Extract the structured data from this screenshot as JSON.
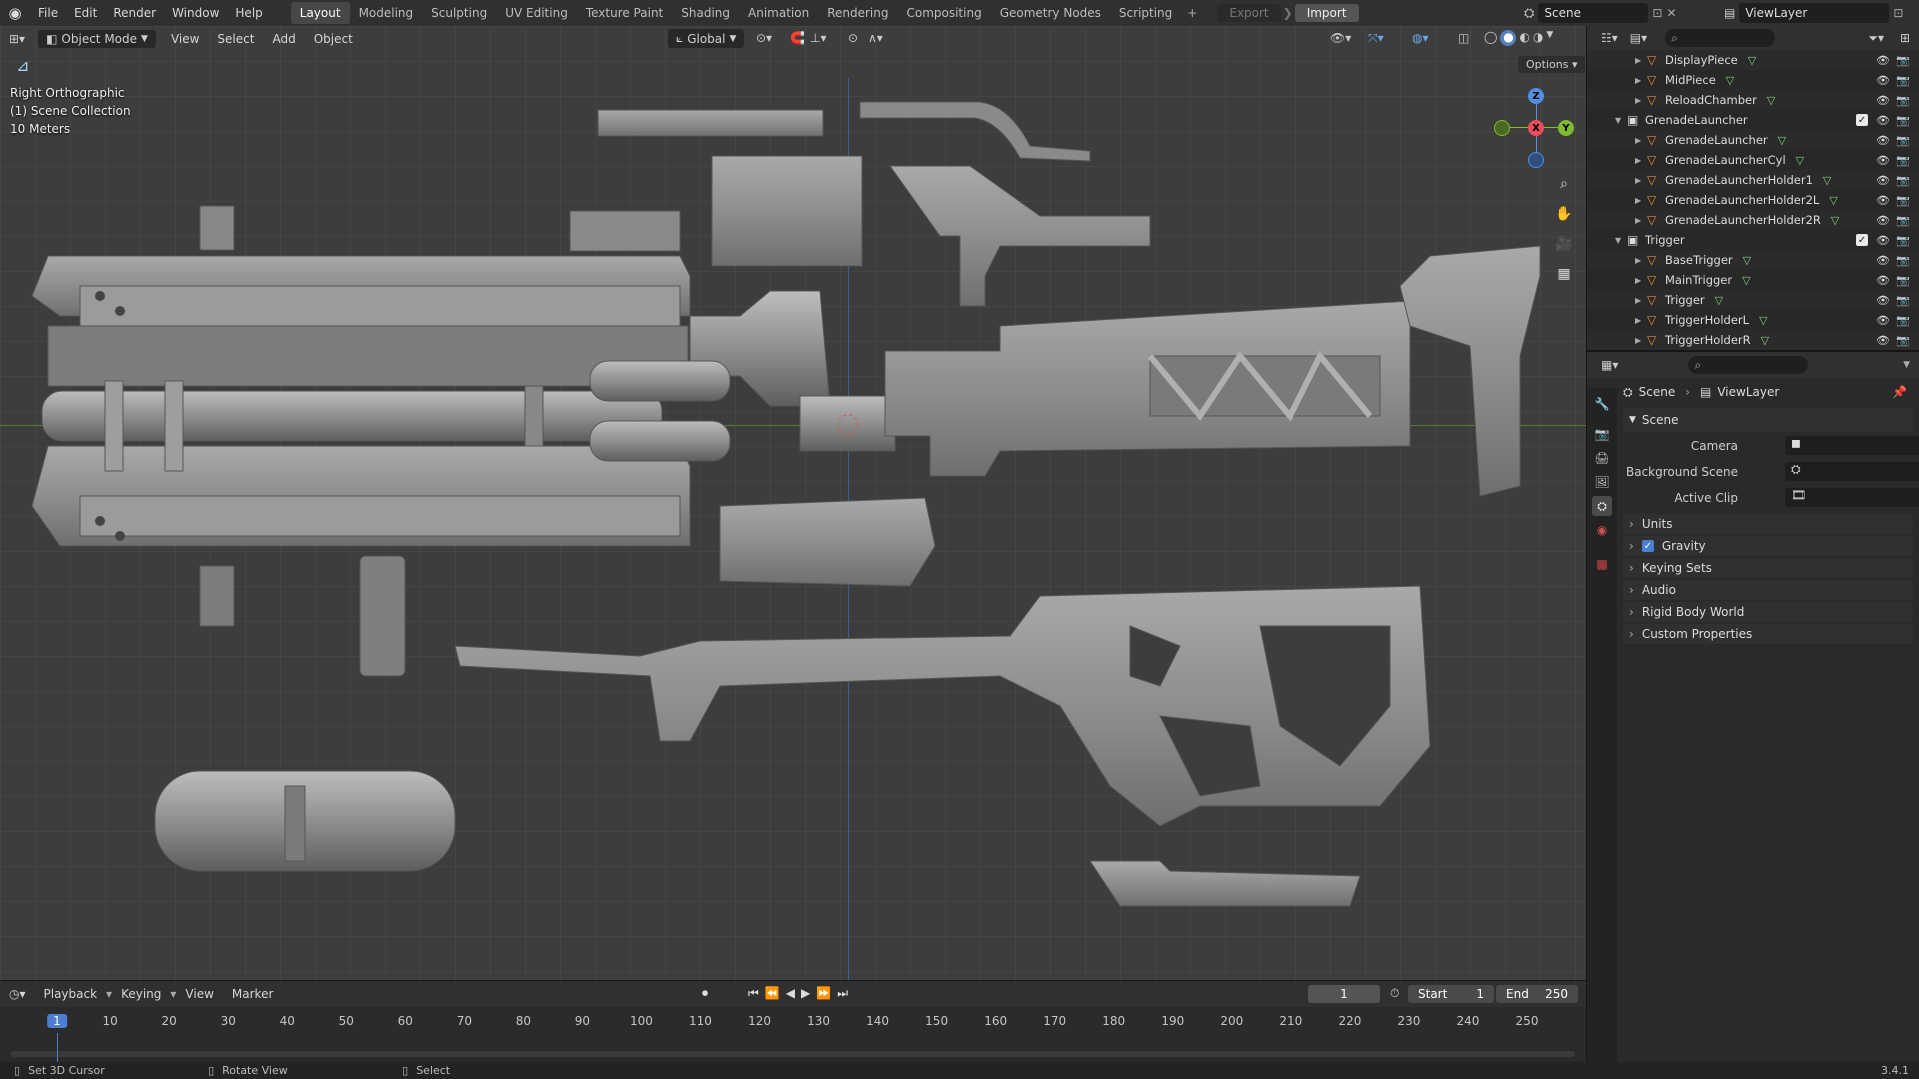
{
  "topbar": {
    "menus": [
      "File",
      "Edit",
      "Render",
      "Window",
      "Help"
    ],
    "workspaces": [
      "Layout",
      "Modeling",
      "Sculpting",
      "UV Editing",
      "Texture Paint",
      "Shading",
      "Animation",
      "Rendering",
      "Compositing",
      "Geometry Nodes",
      "Scripting"
    ],
    "active_workspace": "Layout",
    "export_label": "Export",
    "import_label": "Import",
    "scene_name": "Scene",
    "view_layer": "ViewLayer"
  },
  "viewport": {
    "mode": "Object Mode",
    "menus": [
      "View",
      "Select",
      "Add",
      "Object"
    ],
    "orientation": "Global",
    "options_label": "Options",
    "view_name": "Right Orthographic",
    "collection_label": "(1) Scene Collection",
    "scale_label": "10 Meters",
    "gizmo_axes": {
      "z": "Z",
      "x": "X",
      "y": "Y"
    }
  },
  "outliner": {
    "rows": [
      {
        "name": "DisplayPiece",
        "level": 2,
        "type": "mesh"
      },
      {
        "name": "MidPiece",
        "level": 2,
        "type": "mesh"
      },
      {
        "name": "ReloadChamber",
        "level": 2,
        "type": "mesh"
      },
      {
        "name": "GrenadeLauncher",
        "level": 1,
        "type": "collection"
      },
      {
        "name": "GrenadeLauncher",
        "level": 2,
        "type": "mesh"
      },
      {
        "name": "GrenadeLauncherCyl",
        "level": 2,
        "type": "mesh"
      },
      {
        "name": "GrenadeLauncherHolder1",
        "level": 2,
        "type": "mesh"
      },
      {
        "name": "GrenadeLauncherHolder2L",
        "level": 2,
        "type": "mesh"
      },
      {
        "name": "GrenadeLauncherHolder2R",
        "level": 2,
        "type": "mesh"
      },
      {
        "name": "Trigger",
        "level": 1,
        "type": "collection"
      },
      {
        "name": "BaseTrigger",
        "level": 2,
        "type": "mesh"
      },
      {
        "name": "MainTrigger",
        "level": 2,
        "type": "mesh"
      },
      {
        "name": "Trigger",
        "level": 2,
        "type": "mesh"
      },
      {
        "name": "TriggerHolderL",
        "level": 2,
        "type": "mesh"
      },
      {
        "name": "TriggerHolderR",
        "level": 2,
        "type": "mesh"
      }
    ]
  },
  "properties": {
    "breadcrumb": {
      "scene": "Scene",
      "view_layer": "ViewLayer"
    },
    "scene_panel_title": "Scene",
    "fields": {
      "camera": "Camera",
      "background_scene": "Background Scene",
      "active_clip": "Active Clip"
    },
    "panels": [
      "Units",
      "Gravity",
      "Keying Sets",
      "Audio",
      "Rigid Body World",
      "Custom Properties"
    ],
    "gravity_checked": true
  },
  "timeline": {
    "menus": [
      "Playback",
      "Keying",
      "View",
      "Marker"
    ],
    "current_frame": "1",
    "start_label": "Start",
    "start_value": "1",
    "end_label": "End",
    "end_value": "250",
    "ticks": [
      "1",
      "10",
      "20",
      "30",
      "40",
      "50",
      "60",
      "70",
      "80",
      "90",
      "100",
      "110",
      "120",
      "130",
      "140",
      "150",
      "160",
      "170",
      "180",
      "190",
      "200",
      "210",
      "220",
      "230",
      "240",
      "250"
    ]
  },
  "statusbar": {
    "hints": [
      "Set 3D Cursor",
      "Rotate View",
      "Select"
    ],
    "version": "3.4.1"
  }
}
